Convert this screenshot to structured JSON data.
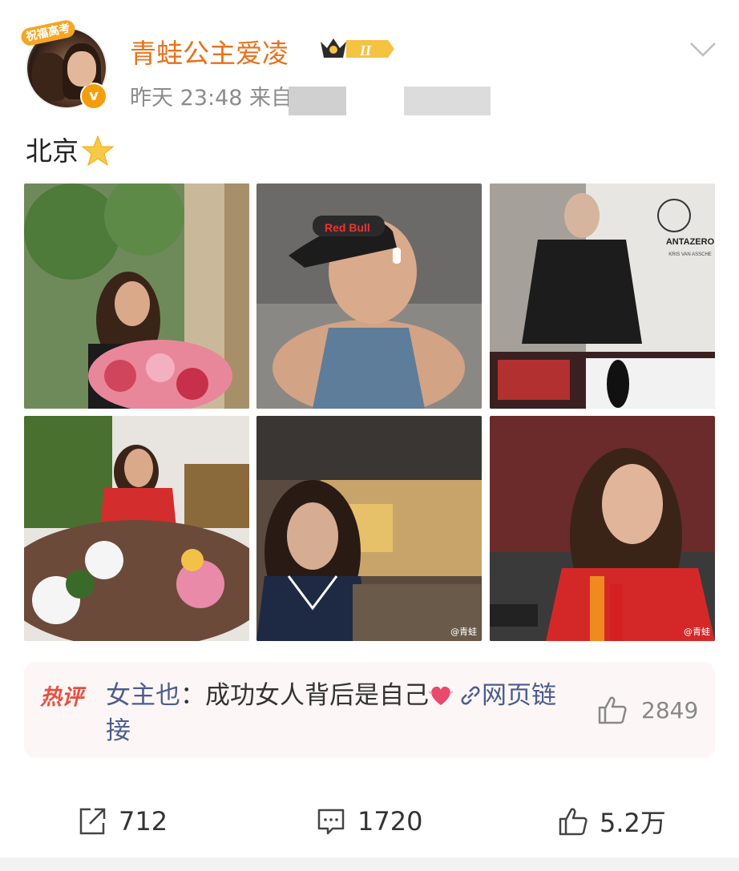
{
  "post": {
    "avatar_badge": "祝福高考",
    "username": "青蛙公主爱凌",
    "level": "II",
    "time": "昨天 23:48",
    "source_prefix": "来自",
    "text": "北京",
    "emoji": "star-emoji"
  },
  "photos": [
    {
      "desc": "woman with flowers",
      "watermark": ""
    },
    {
      "desc": "selfie with visor",
      "watermark": ""
    },
    {
      "desc": "billboard",
      "brand": "ANTAZERO",
      "sub": "KRIS VAN ASSCHE",
      "watermark": ""
    },
    {
      "desc": "banquet",
      "watermark": ""
    },
    {
      "desc": "restaurant",
      "watermark": "@青蛙"
    },
    {
      "desc": "portrait red jacket",
      "watermark": "@青蛙"
    }
  ],
  "hot_comment": {
    "label": "热评",
    "author": "女主也",
    "sep": "：",
    "text": "成功女人背后是自己",
    "link_label": "网页链接",
    "likes": "2849"
  },
  "actions": {
    "repost": "712",
    "comment": "1720",
    "like": "5.2万"
  },
  "colors": {
    "username": "#e8711b",
    "hot_label": "#e8503f",
    "link": "#4c5c8c"
  }
}
